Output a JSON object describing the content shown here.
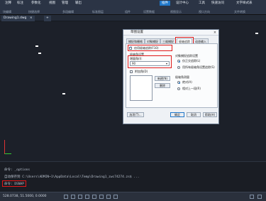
{
  "ribbon": {
    "tabs": [
      "注释",
      "标注",
      "参数化",
      "视图",
      "管理",
      "输出",
      "插件",
      "设计中心",
      "工具",
      "快速访问",
      "文字样式表"
    ],
    "active_tab": "插件",
    "group_labels": [
      "块编辑",
      "快捷选择",
      "多段编辑",
      "标准图层",
      "组件",
      "设置数据",
      "视图显示",
      "视口方向",
      "文件转换"
    ],
    "sub_labels": [
      "绘图",
      "修改",
      "标注",
      "注释",
      "图层",
      "块",
      "特性",
      "组",
      "实用工具"
    ]
  },
  "doc_tabs": {
    "drawing_tab": "Drawing1.dwg",
    "add_label": "+",
    "close_label": "×"
  },
  "dialog": {
    "title": "草图设置",
    "close_glyph": "×",
    "tabs": [
      "捕捉和栅格",
      "对象捕捉",
      "三维捕捉",
      "极轴追踪",
      "动态输入"
    ],
    "active_tab_index": 3,
    "enable_polar_label": "启用极轴追踪(F10)",
    "enable_polar_checked": true,
    "angle_settings_label": "极轴角设置",
    "increment_label": "增量角(I):",
    "increment_value": "90",
    "additional_label": "附加角(D)",
    "additional_checked": false,
    "new_button": "新建(N)",
    "delete_button": "删除",
    "object_snap_tracking_label": "对象捕捉追踪设置",
    "ortho_only_label": "仅正交追踪(L)",
    "all_polar_label": "用所有极轴角设置追踪(S)",
    "polar_measure_label": "极轴角测量",
    "absolute_label": "绝对(A)",
    "relative_label": "相对上一段(R)",
    "options_button": "选项(T)...",
    "ok_button": "确定",
    "cancel_button": "取消",
    "help_button": "帮助(H)"
  },
  "command": {
    "lines": [
      "命令: _options",
      "自动保存到 C:\\Users\\ADMIN~1\\AppData\\Local\\Temp\\Drawing1_zwc74274.zs$ ...",
      "命令: DSNAP"
    ]
  },
  "status": {
    "coords": "528.0738, 51.5000, 0.0000"
  }
}
